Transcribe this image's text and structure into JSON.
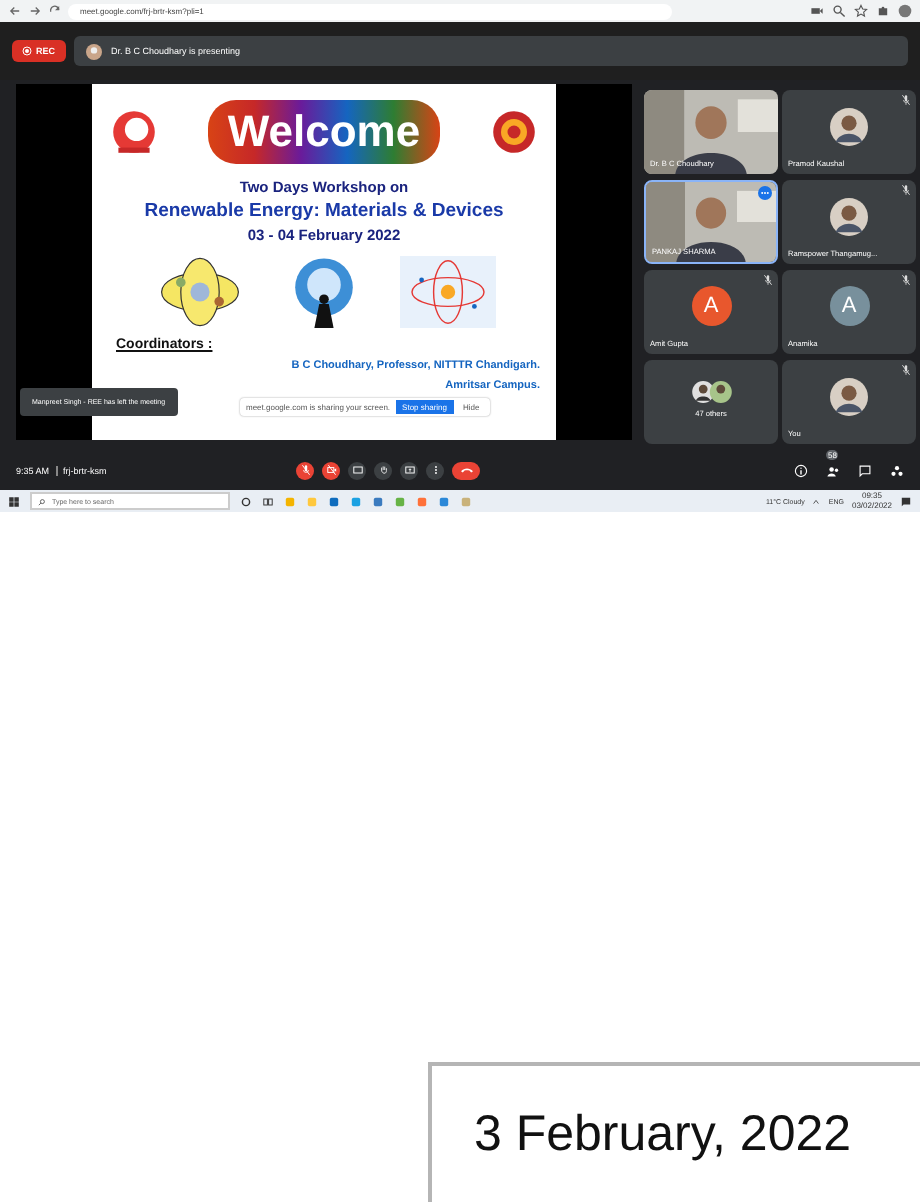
{
  "browser": {
    "url": "meet.google.com/frj-brtr-ksm?pli=1"
  },
  "meet_header": {
    "recording_label": "REC",
    "presenter": "Dr. B C Choudhary is presenting"
  },
  "slide": {
    "welcome": "Welcome",
    "subtitle": "Two Days Workshop on",
    "title": "Renewable Energy: Materials & Devices",
    "dates": "03 - 04 February 2022",
    "coordinators_heading": "Coordinators :",
    "coordinator_lines": [
      "B C Choudhary, Professor, NITTTR Chandigarh.",
      "Amritsar Campus."
    ]
  },
  "toast": "Manpreet Singh - REE has left the meeting",
  "share_banner": {
    "message": "meet.google.com is sharing your screen.",
    "stop": "Stop sharing",
    "hide": "Hide"
  },
  "tiles": [
    {
      "name": "Dr. B C Choudhary",
      "kind": "video",
      "muted": false,
      "speaking": false
    },
    {
      "name": "Pramod Kaushal",
      "muted": true,
      "speaking": false
    },
    {
      "name": "PANKAJ SHARMA",
      "kind": "video",
      "muted": false,
      "speaking": true
    },
    {
      "name": "Ramspower Thangamug...",
      "muted": true,
      "speaking": false
    },
    {
      "name": "Amit Gupta",
      "kind": "letter",
      "letter": "A",
      "color": "#e8572d",
      "muted": true,
      "speaking": false
    },
    {
      "name": "Anamika",
      "kind": "letter",
      "letter": "A",
      "color": "#78909c",
      "muted": true,
      "speaking": false
    },
    {
      "name": "47 others",
      "kind": "others",
      "muted": false,
      "speaking": false
    },
    {
      "name": "You",
      "muted": true,
      "speaking": false
    }
  ],
  "call_bar": {
    "time": "9:35 AM",
    "meeting_code": "frj-brtr-ksm",
    "controls": [
      {
        "kind": "mic",
        "off": true
      },
      {
        "kind": "camera",
        "off": true
      },
      {
        "kind": "captions"
      },
      {
        "kind": "hand"
      },
      {
        "kind": "present"
      },
      {
        "kind": "more"
      },
      {
        "kind": "end"
      }
    ],
    "people_count": "58"
  },
  "taskbar": {
    "search_placeholder": "Type here to search",
    "weather": "11°C Cloudy",
    "language": "ENG",
    "time": "09:35",
    "date": "03/02/2022"
  },
  "caption": "3 February, 2022"
}
